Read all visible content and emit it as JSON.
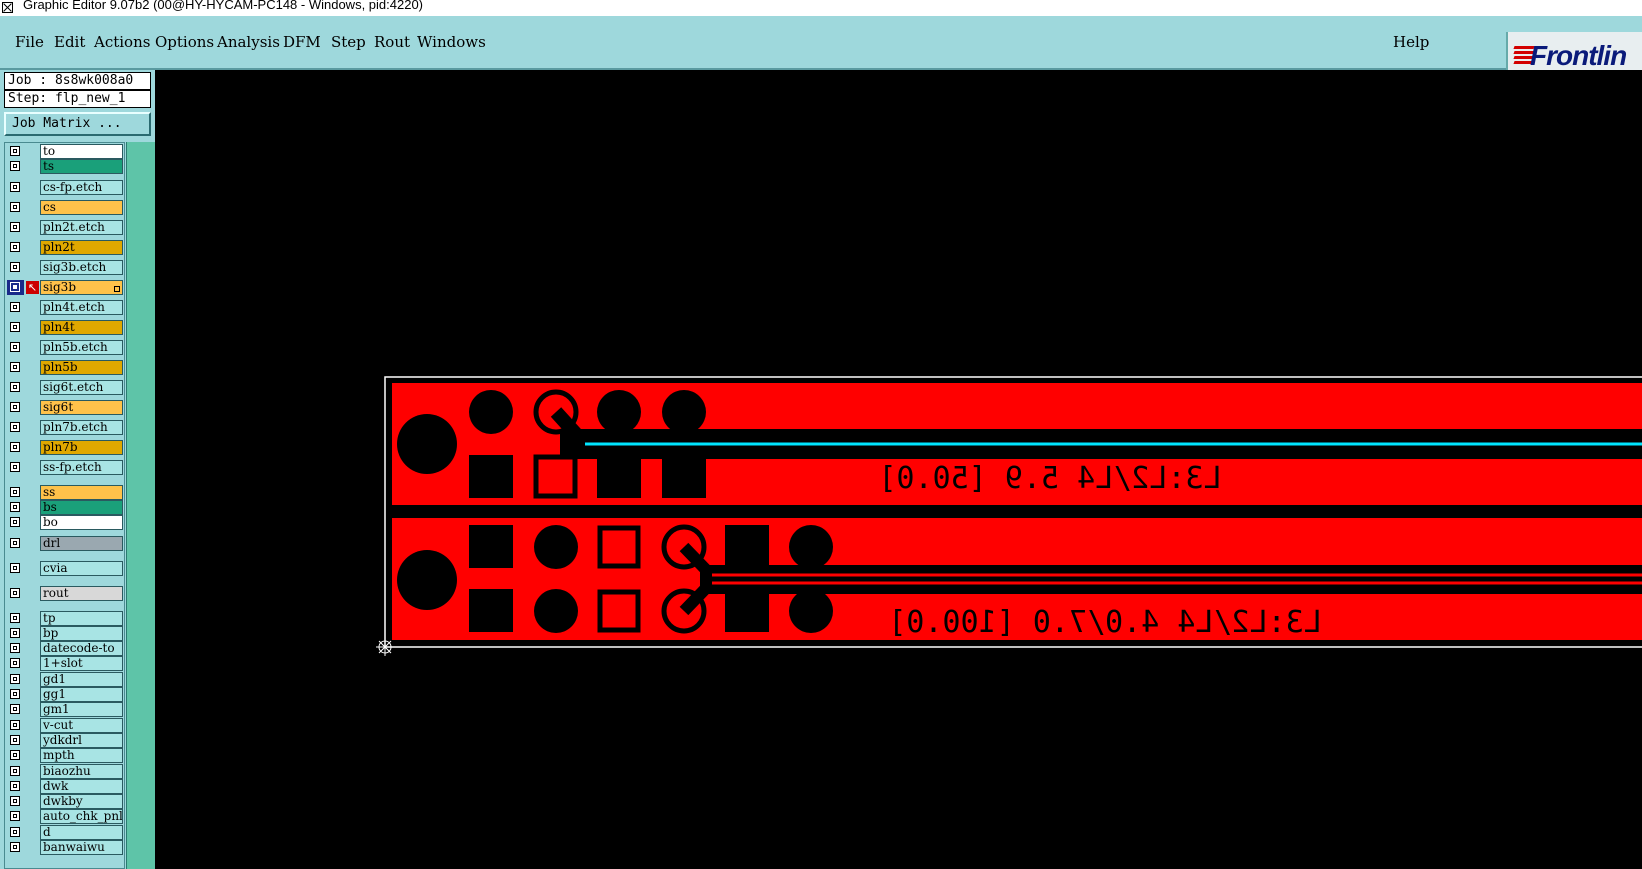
{
  "window": {
    "title": "Graphic Editor 9.07b2 (00@HY-HYCAM-PC148 - Windows, pid:4220)"
  },
  "menubar": {
    "file": "File",
    "edit": "Edit",
    "actions": "Actions",
    "options": "Options",
    "analysis": "Analysis",
    "dfm": "DFM",
    "step": "Step",
    "rout": "Rout",
    "windows": "Windows",
    "help": "Help"
  },
  "logo": {
    "text": "Frontlin"
  },
  "job": {
    "job_line": "Job : 8s8wk008a0",
    "step_line": "Step: flp_new_1",
    "matrix_button": "Job Matrix ..."
  },
  "layers": [
    {
      "name": "to",
      "color": "#ffffff"
    },
    {
      "name": "ts",
      "color": "#1aa07a"
    },
    {
      "name": "cs-fp.etch",
      "color": "#a8e4e4"
    },
    {
      "name": "cs",
      "color": "#ffc24a"
    },
    {
      "name": "pln2t.etch",
      "color": "#a8e4e4"
    },
    {
      "name": "pln2t",
      "color": "#e0a800"
    },
    {
      "name": "sig3b.etch",
      "color": "#a8e4e4"
    },
    {
      "name": "sig3b",
      "color": "#ffc24a"
    },
    {
      "name": "pln4t.etch",
      "color": "#a8e4e4"
    },
    {
      "name": "pln4t",
      "color": "#e0a800"
    },
    {
      "name": "pln5b.etch",
      "color": "#a8e4e4"
    },
    {
      "name": "pln5b",
      "color": "#e0a800"
    },
    {
      "name": "sig6t.etch",
      "color": "#a8e4e4"
    },
    {
      "name": "sig6t",
      "color": "#ffc24a"
    },
    {
      "name": "pln7b.etch",
      "color": "#a8e4e4"
    },
    {
      "name": "pln7b",
      "color": "#e0a800"
    },
    {
      "name": "ss-fp.etch",
      "color": "#a8e4e4"
    },
    {
      "name": "ss",
      "color": "#ffc24a"
    },
    {
      "name": "bs",
      "color": "#1aa07a"
    },
    {
      "name": "bo",
      "color": "#ffffff"
    },
    {
      "name": "drl",
      "color": "#9aa8b0"
    },
    {
      "name": "cvia",
      "color": "#a8e4e4"
    },
    {
      "name": "rout",
      "color": "#d8d8d8"
    },
    {
      "name": "tp",
      "color": "#a8e4e4"
    },
    {
      "name": "bp",
      "color": "#a8e4e4"
    },
    {
      "name": "datecode-to",
      "color": "#a8e4e4"
    },
    {
      "name": "1+slot",
      "color": "#a8e4e4"
    },
    {
      "name": "gd1",
      "color": "#a8e4e4"
    },
    {
      "name": "gg1",
      "color": "#a8e4e4"
    },
    {
      "name": "gm1",
      "color": "#a8e4e4"
    },
    {
      "name": "v-cut",
      "color": "#a8e4e4"
    },
    {
      "name": "ydkdrl",
      "color": "#a8e4e4"
    },
    {
      "name": "mpth",
      "color": "#a8e4e4"
    },
    {
      "name": "biaozhu",
      "color": "#a8e4e4"
    },
    {
      "name": "dwk",
      "color": "#a8e4e4"
    },
    {
      "name": "dwkby",
      "color": "#a8e4e4"
    },
    {
      "name": "auto_chk_pnl",
      "color": "#a8e4e4"
    },
    {
      "name": "d",
      "color": "#a8e4e4"
    },
    {
      "name": "banwaiwu",
      "color": "#a8e4e4"
    }
  ],
  "canvas": {
    "colors": {
      "copper": "#ff0000",
      "trace_highlight": "#00e5ff",
      "profile": "#ffffff",
      "background": "#000000"
    },
    "label_top": "L3:L2/L4 5.9 [50.0]",
    "label_bottom": "L3:L2/L4 4.0/7.0 [100.0]"
  }
}
